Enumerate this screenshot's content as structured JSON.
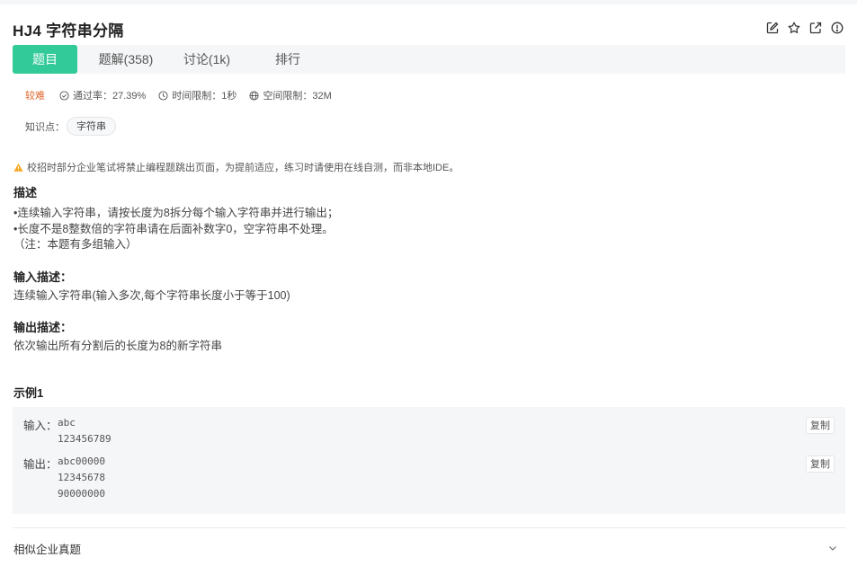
{
  "problem": {
    "title": "HJ4  字符串分隔"
  },
  "header_icons": [
    "edit-icon",
    "star-icon",
    "external-link-icon",
    "info-icon"
  ],
  "tabs": [
    {
      "label": "题目",
      "active": true
    },
    {
      "label": "题解(358)",
      "active": false
    },
    {
      "label": "讨论(1k)",
      "active": false
    },
    {
      "label": "排行",
      "active": false
    }
  ],
  "meta": {
    "difficulty": "较难",
    "pass_rate": "通过率：27.39%",
    "time_limit": "时间限制：1秒",
    "space_limit": "空间限制：32M"
  },
  "knowledge": {
    "label": "知识点：",
    "tag": "字符串"
  },
  "notice": "校招时部分企业笔试将禁止编程题跳出页面，为提前适应，练习时请使用在线自测，而非本地IDE。",
  "description": {
    "title": "描述",
    "lines": [
      "•连续输入字符串，请按长度为8拆分每个输入字符串并进行输出；",
      "•长度不是8整数倍的字符串请在后面补数字0，空字符串不处理。",
      "（注：本题有多组输入）"
    ]
  },
  "input_desc": {
    "title": "输入描述：",
    "text": "连续输入字符串(输入多次,每个字符串长度小于等于100)"
  },
  "output_desc": {
    "title": "输出描述：",
    "text": "依次输出所有分割后的长度为8的新字符串"
  },
  "example": {
    "title": "示例1",
    "input_label": "输入：",
    "input_value": "abc\n123456789",
    "output_label": "输出：",
    "output_value": "abc00000\n12345678\n90000000",
    "copy_label": "复制"
  },
  "similar": {
    "label": "相似企业真题"
  },
  "colors": {
    "accent": "#32ca99",
    "difficulty": "#e0662a",
    "warning": "#f5a623"
  }
}
